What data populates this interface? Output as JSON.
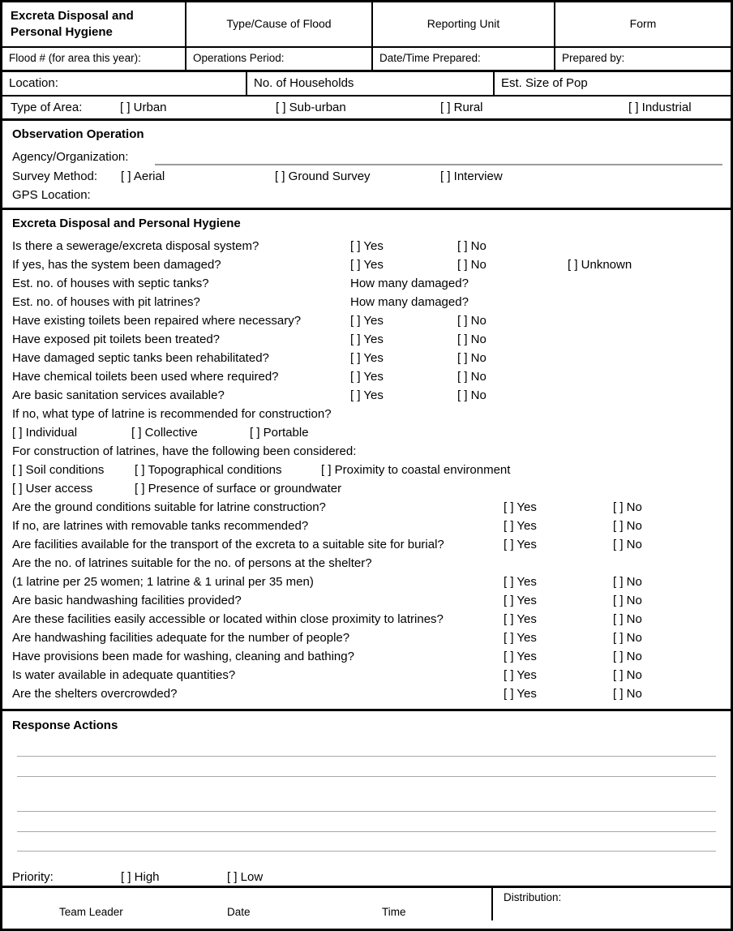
{
  "header": {
    "form_title": "Excreta Disposal and Personal Hygiene",
    "col_type_cause": "Type/Cause of Flood",
    "col_reporting_unit": "Reporting Unit",
    "col_form": "Form",
    "flood_number": "Flood # (for area this year):",
    "operations_period": "Operations Period:",
    "date_time_prepared": "Date/Time Prepared:",
    "prepared_by": "Prepared by:"
  },
  "location_row": {
    "location": "Location:",
    "households": "No. of Households",
    "pop_size": "Est. Size of Pop"
  },
  "area_row": {
    "label": "Type of Area:",
    "options": [
      "[ ] Urban",
      "[ ] Sub-urban",
      "[ ] Rural",
      "[ ] Industrial"
    ]
  },
  "observation": {
    "section_title": "Observation Operation",
    "agency_label": "Agency/Organization:",
    "survey_method_label": "Survey Method:",
    "survey_options": [
      "[ ] Aerial",
      "[ ] Ground Survey",
      "[ ] Interview"
    ],
    "gps_label": "GPS Location:"
  },
  "main": {
    "section_title": "Excreta Disposal and Personal Hygiene",
    "yes": "[ ] Yes",
    "no": "[ ] No",
    "unknown": "[ ] Unknown",
    "how_many_damaged": "How many damaged?",
    "questions": [
      "Is there a sewerage/excreta disposal system?",
      "If yes, has the system been damaged?",
      "Est. no. of houses with septic tanks?",
      "Est. no. of houses with pit latrines?",
      "Have existing toilets been repaired where necessary?",
      "Have exposed pit toilets been treated?",
      "Have damaged septic tanks been rehabilitated?",
      "Have chemical toilets been used where required?",
      "Are basic sanitation services available?",
      "If no, what type of latrine is recommended for construction?"
    ],
    "latrine_types": [
      "[ ] Individual",
      "[ ] Collective",
      "[ ] Portable"
    ],
    "construction_intro": "For construction of latrines, have the following been considered:",
    "considerations_row1": [
      "[ ] Soil conditions",
      "[ ] Topographical conditions",
      "[  ] Proximity to coastal environment"
    ],
    "considerations_row2": [
      "[ ] User access",
      "[ ] Presence of surface or groundwater"
    ],
    "questions_lower": [
      "Are the ground conditions suitable for latrine construction?",
      "If no, are latrines with removable tanks recommended?",
      "Are facilities available for the transport of the excreta to a suitable site for burial?",
      "Are the no. of latrines suitable for the no. of persons at the shelter?",
      "(1 latrine per 25 women; 1 latrine & 1 urinal per 35 men)",
      "Are basic handwashing facilities provided?",
      "Are these facilities easily accessible or located within close proximity to latrines?",
      "Are handwashing facilities adequate for the number of people?",
      "Have provisions been made for washing, cleaning and bathing?",
      "Is water available in adequate quantities?",
      "Are the shelters overcrowded?"
    ]
  },
  "response": {
    "section_title": "Response Actions",
    "priority_label": "Priority:",
    "priority_options": [
      "[ ] High",
      "[ ] Low"
    ]
  },
  "footer": {
    "team_leader": "Team Leader",
    "date": "Date",
    "time": "Time",
    "distribution": "Distribution:"
  },
  "colors": {
    "border": "#000000",
    "write_line": "#a8a8a8",
    "page_bg": "#ffffff"
  }
}
